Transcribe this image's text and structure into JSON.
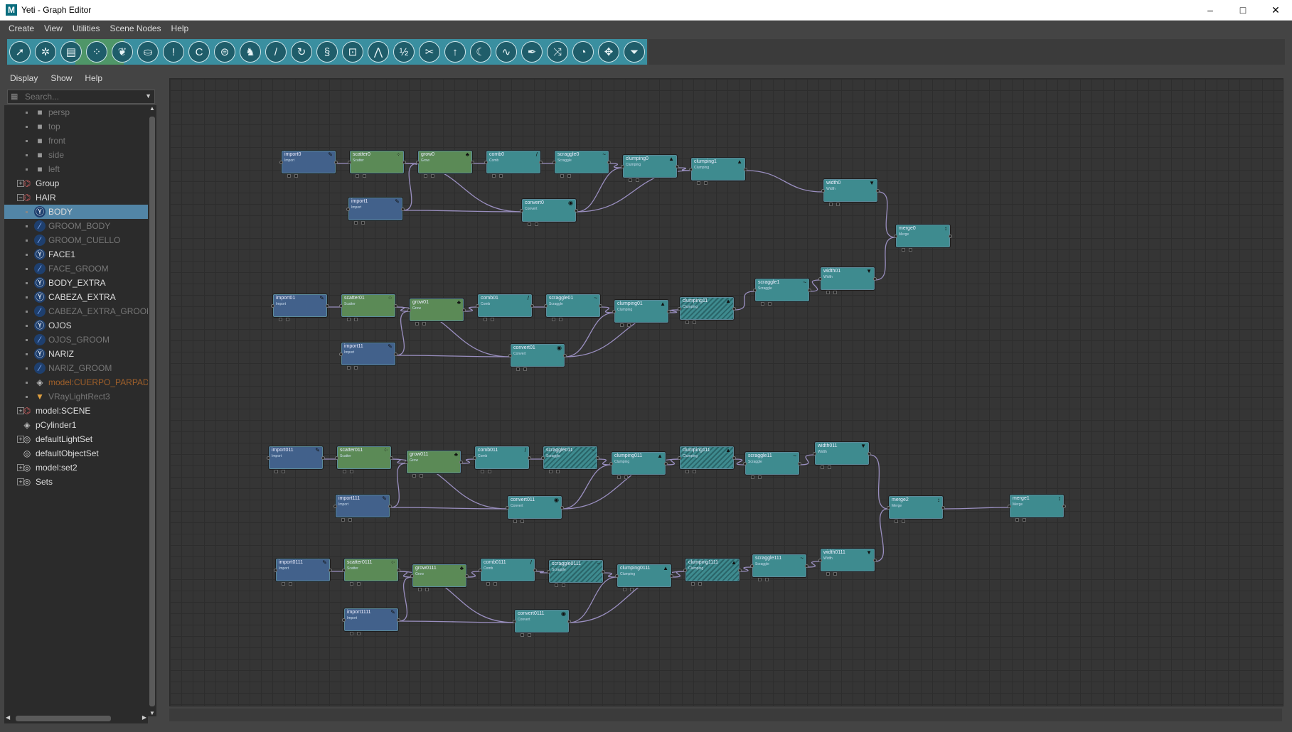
{
  "window": {
    "title": "Yeti - Graph Editor",
    "logo": "M",
    "controls": [
      "minimize-icon",
      "maximize-icon",
      "close-icon"
    ]
  },
  "menubar": [
    "Create",
    "View",
    "Utilities",
    "Scene Nodes",
    "Help"
  ],
  "toolbar": {
    "icons": [
      "select-arrow-icon",
      "transform-icon",
      "box-icon",
      "scatter-icon",
      "grow-icon",
      "bucket-icon",
      "exclaim-icon",
      "curve-icon",
      "pipe-icon",
      "bat-icon",
      "brush-icon",
      "rotate-icon",
      "curl-icon",
      "tape-icon",
      "wave-icon",
      "fraction-icon",
      "split-icon",
      "up-arrow-icon",
      "moon-icon",
      "stroke-icon",
      "pen-icon",
      "shuffle-icon",
      "palette-icon",
      "move-icon",
      "filter-icon"
    ]
  },
  "outliner": {
    "menu": [
      "Display",
      "Show",
      "Help"
    ],
    "search": {
      "placeholder": "Search..."
    },
    "items": [
      {
        "label": "persp",
        "depth": 1,
        "icon": "camera-icon",
        "dim": true
      },
      {
        "label": "top",
        "depth": 1,
        "icon": "camera-icon",
        "dim": true
      },
      {
        "label": "front",
        "depth": 1,
        "icon": "camera-icon",
        "dim": true
      },
      {
        "label": "side",
        "depth": 1,
        "icon": "camera-icon",
        "dim": true
      },
      {
        "label": "left",
        "depth": 1,
        "icon": "camera-icon",
        "dim": true
      },
      {
        "label": "Group",
        "depth": 0,
        "icon": "group-icon",
        "expand": "+"
      },
      {
        "label": "HAIR",
        "depth": 0,
        "icon": "group-icon",
        "expand": "-"
      },
      {
        "label": "BODY",
        "depth": 1,
        "icon": "yeti-node-icon",
        "selected": true
      },
      {
        "label": "GROOM_BODY",
        "depth": 1,
        "icon": "groom-icon",
        "dim": true
      },
      {
        "label": "GROOM_CUELLO",
        "depth": 1,
        "icon": "groom-icon",
        "dim": true
      },
      {
        "label": "FACE1",
        "depth": 1,
        "icon": "yeti-node-icon"
      },
      {
        "label": "FACE_GROOM",
        "depth": 1,
        "icon": "groom-icon",
        "dim": true
      },
      {
        "label": "BODY_EXTRA",
        "depth": 1,
        "icon": "yeti-node-icon"
      },
      {
        "label": "CABEZA_EXTRA",
        "depth": 1,
        "icon": "yeti-node-icon"
      },
      {
        "label": "CABEZA_EXTRA_GROOM",
        "depth": 1,
        "icon": "groom-icon",
        "dim": true
      },
      {
        "label": "OJOS",
        "depth": 1,
        "icon": "yeti-node-icon"
      },
      {
        "label": "OJOS_GROOM",
        "depth": 1,
        "icon": "groom-icon",
        "dim": true
      },
      {
        "label": "NARIZ",
        "depth": 1,
        "icon": "yeti-node-icon"
      },
      {
        "label": "NARIZ_GROOM",
        "depth": 1,
        "icon": "groom-icon",
        "dim": true
      },
      {
        "label": "model:CUERPO_PARPADO",
        "depth": 1,
        "icon": "mesh-icon",
        "orange": true
      },
      {
        "label": "VRayLightRect3",
        "depth": 1,
        "icon": "light-icon",
        "dim": true
      },
      {
        "label": "model:SCENE",
        "depth": 0,
        "icon": "group-icon",
        "expand": "+"
      },
      {
        "label": "pCylinder1",
        "depth": 0,
        "icon": "mesh-icon"
      },
      {
        "label": "defaultLightSet",
        "depth": 0,
        "icon": "set-icon",
        "expand": "+"
      },
      {
        "label": "defaultObjectSet",
        "depth": 0,
        "icon": "set-icon"
      },
      {
        "label": "model:set2",
        "depth": 0,
        "icon": "set-icon",
        "expand": "+"
      },
      {
        "label": "Sets",
        "depth": 0,
        "icon": "set-icon",
        "expand": "+"
      }
    ]
  },
  "graph": {
    "nodes": [
      {
        "id": "import0",
        "label": "import0",
        "type": "Import",
        "color": "blue",
        "icon": "✎"
      },
      {
        "id": "scatter0",
        "label": "scatter0",
        "type": "Scatter",
        "color": "green",
        "icon": "⁘"
      },
      {
        "id": "grow0",
        "label": "grow0",
        "type": "Grow",
        "color": "green",
        "icon": "♣"
      },
      {
        "id": "comb0",
        "label": "comb0",
        "type": "Comb",
        "color": "teal",
        "icon": "/"
      },
      {
        "id": "scraggle0",
        "label": "scraggle0",
        "type": "Scraggle",
        "color": "teal",
        "icon": "~"
      },
      {
        "id": "clumping0",
        "label": "clumping0",
        "type": "Clumping",
        "color": "teal",
        "icon": "▲"
      },
      {
        "id": "clumping1",
        "label": "clumping1",
        "type": "Clumping",
        "color": "teal",
        "icon": "▲"
      },
      {
        "id": "width0",
        "label": "width0",
        "type": "Width",
        "color": "teal",
        "icon": "▼"
      },
      {
        "id": "import1",
        "label": "import1",
        "type": "Import",
        "color": "blue",
        "icon": "✎"
      },
      {
        "id": "convert0",
        "label": "convert0",
        "type": "Convert",
        "color": "teal",
        "icon": "◉"
      },
      {
        "id": "merge0",
        "label": "merge0",
        "type": "Merge",
        "color": "teal",
        "icon": "↕"
      },
      {
        "id": "import01",
        "label": "import01",
        "type": "Import",
        "color": "blue",
        "icon": "✎"
      },
      {
        "id": "scatter01",
        "label": "scatter01",
        "type": "Scatter",
        "color": "green",
        "icon": "⁘"
      },
      {
        "id": "grow01",
        "label": "grow01",
        "type": "Grow",
        "color": "green",
        "icon": "♣"
      },
      {
        "id": "comb01",
        "label": "comb01",
        "type": "Comb",
        "color": "teal",
        "icon": "/"
      },
      {
        "id": "scraggle01",
        "label": "scraggle01",
        "type": "Scraggle",
        "color": "teal",
        "icon": "~"
      },
      {
        "id": "clumping01",
        "label": "clumping01",
        "type": "Clumping",
        "color": "teal",
        "icon": "▲"
      },
      {
        "id": "clumping11",
        "label": "clumping11",
        "type": "Clumping",
        "color": "hatch",
        "icon": "▲"
      },
      {
        "id": "scraggle1",
        "label": "scraggle1",
        "type": "Scraggle",
        "color": "teal",
        "icon": "~"
      },
      {
        "id": "width01",
        "label": "width01",
        "type": "Width",
        "color": "teal",
        "icon": "▼"
      },
      {
        "id": "import11",
        "label": "import11",
        "type": "Import",
        "color": "blue",
        "icon": "✎"
      },
      {
        "id": "convert01",
        "label": "convert01",
        "type": "Convert",
        "color": "teal",
        "icon": "◉"
      },
      {
        "id": "import011",
        "label": "import011",
        "type": "Import",
        "color": "blue",
        "icon": "✎"
      },
      {
        "id": "scatter011",
        "label": "scatter011",
        "type": "Scatter",
        "color": "green",
        "icon": "⁘"
      },
      {
        "id": "grow011",
        "label": "grow011",
        "type": "Grow",
        "color": "green",
        "icon": "♣"
      },
      {
        "id": "comb011",
        "label": "comb011",
        "type": "Comb",
        "color": "teal",
        "icon": "/"
      },
      {
        "id": "scraggle011",
        "label": "scraggle011",
        "type": "Scraggle",
        "color": "hatch",
        "icon": "~"
      },
      {
        "id": "clumping011",
        "label": "clumping011",
        "type": "Clumping",
        "color": "teal",
        "icon": "▲"
      },
      {
        "id": "clumping111",
        "label": "clumping111",
        "type": "Clumping",
        "color": "hatch",
        "icon": "▲"
      },
      {
        "id": "scraggle11",
        "label": "scraggle11",
        "type": "Scraggle",
        "color": "teal",
        "icon": "~"
      },
      {
        "id": "width011",
        "label": "width011",
        "type": "Width",
        "color": "teal",
        "icon": "▼"
      },
      {
        "id": "import111",
        "label": "import111",
        "type": "Import",
        "color": "blue",
        "icon": "✎"
      },
      {
        "id": "convert011",
        "label": "convert011",
        "type": "Convert",
        "color": "teal",
        "icon": "◉"
      },
      {
        "id": "merge2",
        "label": "merge2",
        "type": "Merge",
        "color": "teal",
        "icon": "↕"
      },
      {
        "id": "merge1",
        "label": "merge1",
        "type": "Merge",
        "color": "teal",
        "icon": "↕"
      },
      {
        "id": "import0111",
        "label": "import0111",
        "type": "Import",
        "color": "blue",
        "icon": "✎"
      },
      {
        "id": "scatter0111",
        "label": "scatter0111",
        "type": "Scatter",
        "color": "green",
        "icon": "⁘"
      },
      {
        "id": "grow0111",
        "label": "grow0111",
        "type": "Grow",
        "color": "green",
        "icon": "♣"
      },
      {
        "id": "comb0111",
        "label": "comb0111",
        "type": "Comb",
        "color": "teal",
        "icon": "/"
      },
      {
        "id": "scraggle0111",
        "label": "scraggle0111",
        "type": "Scraggle",
        "color": "hatch",
        "icon": "~"
      },
      {
        "id": "clumping0111",
        "label": "clumping0111",
        "type": "Clumping",
        "color": "teal",
        "icon": "▲"
      },
      {
        "id": "clumping1111",
        "label": "clumping1111",
        "type": "Clumping",
        "color": "hatch",
        "icon": "▲"
      },
      {
        "id": "scraggle111",
        "label": "scraggle111",
        "type": "Scraggle",
        "color": "teal",
        "icon": "~"
      },
      {
        "id": "width0111",
        "label": "width0111",
        "type": "Width",
        "color": "teal",
        "icon": "▼"
      },
      {
        "id": "import1111",
        "label": "import1111",
        "type": "Import",
        "color": "blue",
        "icon": "✎"
      },
      {
        "id": "convert0111",
        "label": "convert0111",
        "type": "Convert",
        "color": "teal",
        "icon": "◉"
      }
    ],
    "edges": [
      [
        "import0",
        "scatter0"
      ],
      [
        "scatter0",
        "grow0"
      ],
      [
        "grow0",
        "comb0"
      ],
      [
        "comb0",
        "scraggle0"
      ],
      [
        "scraggle0",
        "clumping0"
      ],
      [
        "clumping0",
        "clumping1"
      ],
      [
        "clumping1",
        "width0"
      ],
      [
        "width0",
        "merge0"
      ],
      [
        "import1",
        "convert0"
      ],
      [
        "convert0",
        "clumping0"
      ],
      [
        "convert0",
        "clumping1"
      ],
      [
        "import1",
        "grow0"
      ],
      [
        "scatter0",
        "convert0"
      ],
      [
        "width01",
        "merge0"
      ],
      [
        "import01",
        "scatter01"
      ],
      [
        "scatter01",
        "grow01"
      ],
      [
        "grow01",
        "comb01"
      ],
      [
        "comb01",
        "scraggle01"
      ],
      [
        "scraggle01",
        "clumping01"
      ],
      [
        "clumping01",
        "clumping11"
      ],
      [
        "clumping11",
        "scraggle1"
      ],
      [
        "scraggle1",
        "width01"
      ],
      [
        "import11",
        "convert01"
      ],
      [
        "convert01",
        "clumping01"
      ],
      [
        "convert01",
        "clumping11"
      ],
      [
        "import11",
        "grow01"
      ],
      [
        "scatter01",
        "convert01"
      ],
      [
        "import011",
        "scatter011"
      ],
      [
        "scatter011",
        "grow011"
      ],
      [
        "grow011",
        "comb011"
      ],
      [
        "comb011",
        "scraggle011"
      ],
      [
        "scraggle011",
        "clumping011"
      ],
      [
        "clumping011",
        "clumping111"
      ],
      [
        "clumping111",
        "scraggle11"
      ],
      [
        "scraggle11",
        "width011"
      ],
      [
        "width011",
        "merge2"
      ],
      [
        "import111",
        "convert011"
      ],
      [
        "convert011",
        "clumping011"
      ],
      [
        "convert011",
        "clumping111"
      ],
      [
        "import111",
        "grow011"
      ],
      [
        "scatter011",
        "convert011"
      ],
      [
        "merge2",
        "merge1"
      ],
      [
        "import0111",
        "scatter0111"
      ],
      [
        "scatter0111",
        "grow0111"
      ],
      [
        "grow0111",
        "comb0111"
      ],
      [
        "comb0111",
        "scraggle0111"
      ],
      [
        "scraggle0111",
        "clumping0111"
      ],
      [
        "clumping0111",
        "clumping1111"
      ],
      [
        "clumping1111",
        "scraggle111"
      ],
      [
        "scraggle111",
        "width0111"
      ],
      [
        "width0111",
        "merge2"
      ],
      [
        "import1111",
        "convert0111"
      ],
      [
        "convert0111",
        "clumping0111"
      ],
      [
        "convert0111",
        "clumping1111"
      ],
      [
        "import1111",
        "grow0111"
      ],
      [
        "scatter0111",
        "convert0111"
      ]
    ]
  },
  "colors": {
    "blue": "#42618b",
    "green": "#5b8a56",
    "teal": "#3e8b8f",
    "wire": "#9a8fc0",
    "selection": "#5285a6"
  }
}
